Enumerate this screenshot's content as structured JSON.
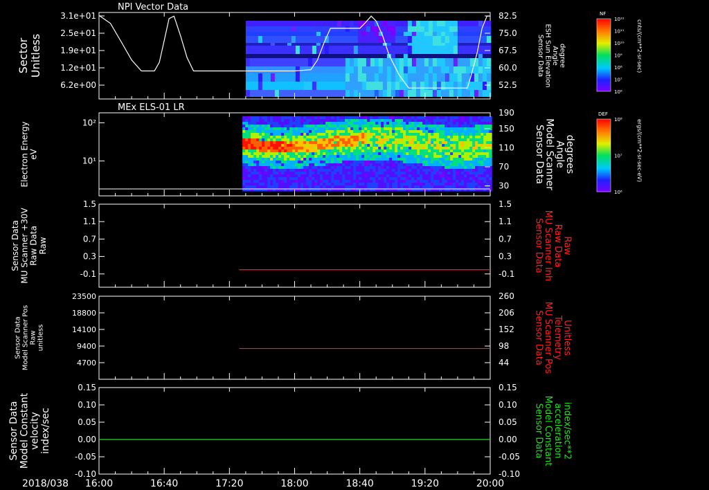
{
  "colors": {
    "background": "#000000",
    "foreground": "#ffffff",
    "red_trace": "#ff2020",
    "green_trace": "#20e020",
    "axis_red_label": "#ff2020",
    "axis_green_label": "#20e020"
  },
  "x_axis": {
    "date": "2018/038",
    "ticks": [
      "16:00",
      "16:40",
      "17:20",
      "18:00",
      "18:40",
      "19:20",
      "20:00"
    ]
  },
  "chart_data": [
    {
      "type": "heatmap",
      "id": "p1",
      "title": "NPI Vector Data",
      "ylabel": [
        "Sector",
        "Unitless"
      ],
      "yticks": [
        "3.1e+01",
        "2.5e+01",
        "1.9e+01",
        "1.2e+01",
        "6.2e+00"
      ],
      "y2label": [
        "Sensor Data",
        "ESH Sun Elevation",
        "Angle",
        "degree"
      ],
      "y2ticks": [
        "82.5",
        "75.0",
        "67.5",
        "60.0",
        "52.5"
      ],
      "y2lim": [
        47,
        82.5
      ],
      "colorbar": {
        "label": "NF",
        "ticks": [
          "10¹²",
          "10¹¹",
          "10¹⁰",
          "10⁹",
          "10⁸",
          "10⁷",
          "10⁶"
        ],
        "unit": "cnts/(cm**2-sr-sec)"
      },
      "data_start": "17:30",
      "line": {
        "name": "ESH Sun Elevation Angle",
        "x": [
          "16:00",
          "16:07",
          "16:14",
          "16:20",
          "16:26",
          "16:30",
          "16:34",
          "16:37",
          "16:40",
          "16:43",
          "16:46",
          "16:50",
          "16:54",
          "16:58",
          "17:10",
          "17:30",
          "18:00",
          "18:10",
          "18:14",
          "18:18",
          "18:22",
          "18:28",
          "18:35",
          "18:40",
          "18:43",
          "18:47",
          "18:50",
          "18:54",
          "18:58",
          "19:04",
          "19:10",
          "19:22",
          "19:46",
          "19:48",
          "19:52",
          "19:55",
          "19:58",
          "20:00"
        ],
        "y": [
          81.3,
          78,
          70,
          63,
          58.5,
          58.5,
          58.5,
          62,
          71,
          80,
          81,
          73,
          64,
          58.5,
          58.5,
          58.5,
          58.5,
          59,
          63,
          70,
          76,
          76,
          76,
          76,
          78,
          81,
          79,
          73,
          65,
          57,
          51.5,
          51.5,
          51.5,
          56,
          66,
          76,
          81,
          81
        ]
      }
    },
    {
      "type": "heatmap",
      "id": "p2",
      "title": "MEx ELS-01 LR",
      "ylabel": [
        "Electron Energy",
        "eV"
      ],
      "yticks": [
        "10²",
        "10¹"
      ],
      "y2label": [
        "Sensor Data",
        "Model Scanner",
        "Angle",
        "degrees"
      ],
      "y2ticks": [
        "190",
        "150",
        "110",
        "70",
        "30"
      ],
      "colorbar": {
        "label": "DEF",
        "ticks": [
          "10⁸",
          "10⁷",
          "10⁶"
        ],
        "unit": "ergs/(cm**2-sr-sec-eV)"
      },
      "data_start": "17:28"
    },
    {
      "type": "line",
      "id": "p3",
      "ylabel": [
        "Sensor Data",
        "MU Scanner +30V",
        "Raw Data",
        "Raw"
      ],
      "yticks": [
        "1.5",
        "1.1",
        "0.7",
        "0.3",
        "-0.1"
      ],
      "ylim": [
        -0.4,
        1.5
      ],
      "y2label": [
        "Sensor Data",
        "MU Scanner Inh",
        "Raw Data",
        "Raw"
      ],
      "y2ticks": [
        "1.5",
        "1.1",
        "0.7",
        "0.3",
        "-0.1"
      ],
      "series": [
        {
          "color": "red",
          "x": [
            "17:26",
            "20:00"
          ],
          "y": [
            0.0,
            0.0
          ]
        }
      ]
    },
    {
      "type": "line",
      "id": "p4",
      "ylabel": [
        "Sensor Data",
        "Model Scanner Pos",
        "Raw",
        "unitless"
      ],
      "yticks": [
        "23500",
        "18800",
        "14100",
        "9400",
        "4700"
      ],
      "y2label": [
        "Sensor Data",
        "MU Scanner Pos",
        "Telemetry",
        "Unitless"
      ],
      "y2ticks": [
        "260",
        "206",
        "152",
        "98",
        "44"
      ],
      "y2lim": [
        -10,
        260
      ],
      "series": [
        {
          "color": "red",
          "x": [
            "17:26",
            "20:00"
          ],
          "y2": [
            90,
            90
          ]
        }
      ]
    },
    {
      "type": "line",
      "id": "p5",
      "ylabel": [
        "Sensor Data",
        "Model Constant",
        "velocity",
        "index/sec"
      ],
      "yticks": [
        "0.15",
        "0.10",
        "0.05",
        "0.00",
        "-0.05",
        "-0.10"
      ],
      "ylim": [
        -0.1,
        0.15
      ],
      "y2label": [
        "Sensor Data",
        "Model Constant",
        "acceleration",
        "index/sec**2"
      ],
      "y2ticks": [
        "0.15",
        "0.10",
        "0.05",
        "0.00",
        "-0.05",
        "-0.10"
      ],
      "series": [
        {
          "color": "green",
          "x": [
            "16:00",
            "20:00"
          ],
          "y": [
            0.0,
            0.0
          ]
        }
      ]
    }
  ]
}
